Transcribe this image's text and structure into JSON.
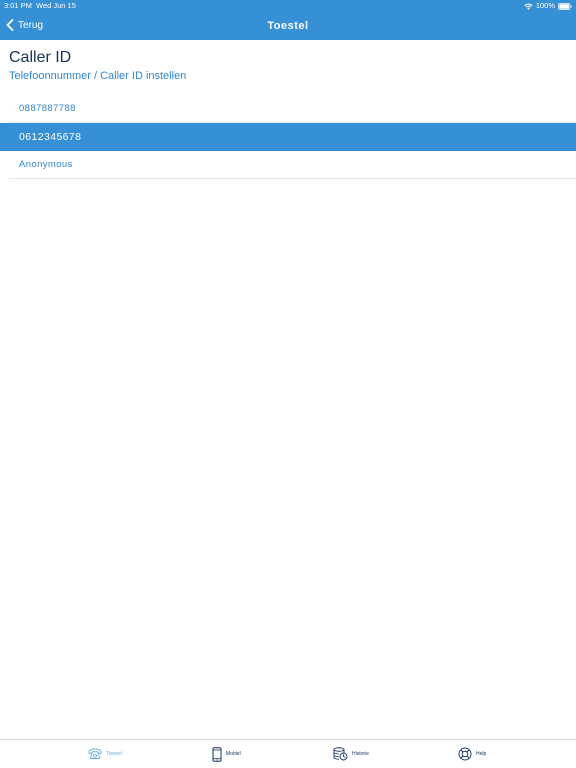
{
  "status_bar": {
    "time": "3:01 PM",
    "date": "Wed Jun 15",
    "battery": "100%"
  },
  "nav": {
    "back_label": "Terug",
    "title": "Toestel"
  },
  "page": {
    "title": "Caller ID",
    "subtitle": "Telefoonnummer / Caller ID instellen"
  },
  "options": [
    {
      "label": "0887887788",
      "selected": false
    },
    {
      "label": "0612345678",
      "selected": true
    },
    {
      "label": "Anonymous",
      "selected": false
    }
  ],
  "tabs": [
    {
      "label": "Toestel",
      "icon": "desk-phone-icon",
      "active": true
    },
    {
      "label": "Mobiel",
      "icon": "mobile-phone-icon",
      "active": false
    },
    {
      "label": "Historie",
      "icon": "history-icon",
      "active": false
    },
    {
      "label": "Help",
      "icon": "lifebuoy-icon",
      "active": false
    }
  ],
  "colors": {
    "primary": "#3590d5",
    "title_text": "#16335e",
    "accent_text": "#2f86cf",
    "active_tab": "#6aaee0"
  }
}
